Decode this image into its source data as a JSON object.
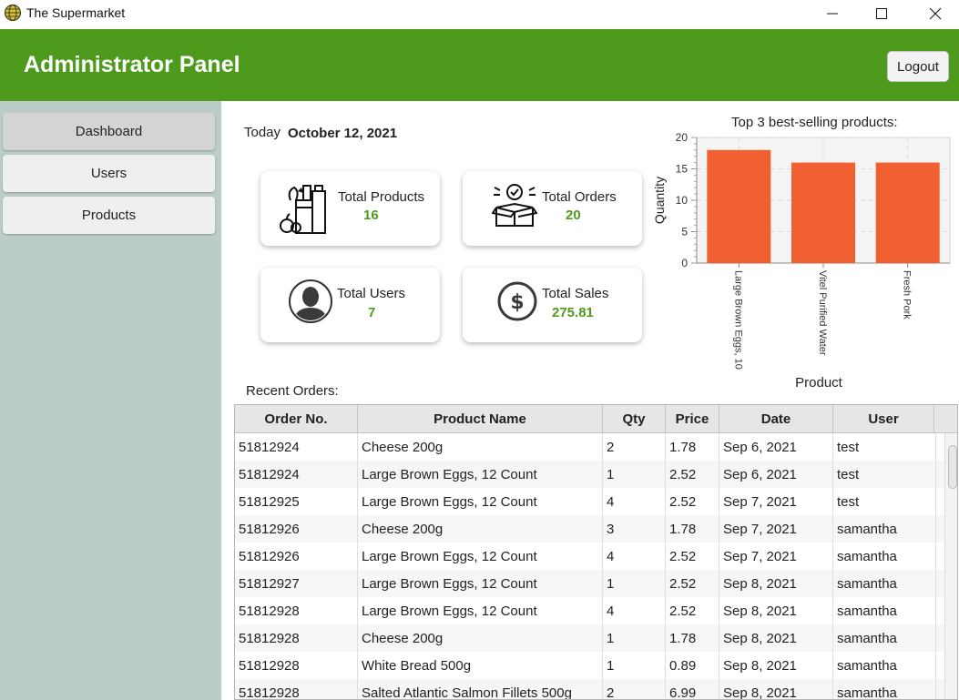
{
  "window": {
    "title": "The Supermarket"
  },
  "header": {
    "title": "Administrator Panel",
    "logout_label": "Logout"
  },
  "sidebar": {
    "items": [
      {
        "label": "Dashboard",
        "active": true
      },
      {
        "label": "Users",
        "active": false
      },
      {
        "label": "Products",
        "active": false
      }
    ]
  },
  "dashboard": {
    "today_label": "Today",
    "today_date": "October 12, 2021",
    "cards": [
      {
        "label": "Total Products",
        "value": "16",
        "icon": "groceries-icon"
      },
      {
        "label": "Total Orders",
        "value": "20",
        "icon": "order-box-icon"
      },
      {
        "label": "Total Users",
        "value": "7",
        "icon": "user-avatar-icon"
      },
      {
        "label": "Total Sales",
        "value": "275.81",
        "icon": "dollar-coin-icon"
      }
    ]
  },
  "chart_data": {
    "type": "bar",
    "title": "Top 3 best-selling products:",
    "xlabel": "Product",
    "ylabel": "Quantity",
    "categories": [
      "Large Brown Eggs, 10",
      "Vitel Purified Water",
      "Fresh Pork"
    ],
    "values": [
      18,
      16,
      16
    ],
    "ylim": [
      0,
      20
    ],
    "yticks": [
      0,
      5,
      10,
      15,
      20
    ],
    "grid": true,
    "bar_color": "#f06030"
  },
  "orders": {
    "label": "Recent Orders:",
    "columns": [
      "Order No.",
      "Product Name",
      "Qty",
      "Price",
      "Date",
      "User"
    ],
    "rows": [
      [
        "51812924",
        "Cheese 200g",
        "2",
        "1.78",
        "Sep 6, 2021",
        "test"
      ],
      [
        "51812924",
        "Large Brown Eggs, 12 Count",
        "1",
        "2.52",
        "Sep 6, 2021",
        "test"
      ],
      [
        "51812925",
        "Large Brown Eggs, 12 Count",
        "4",
        "2.52",
        "Sep 7, 2021",
        "test"
      ],
      [
        "51812926",
        "Cheese 200g",
        "3",
        "1.78",
        "Sep 7, 2021",
        "samantha"
      ],
      [
        "51812926",
        "Large Brown Eggs, 12 Count",
        "4",
        "2.52",
        "Sep 7, 2021",
        "samantha"
      ],
      [
        "51812927",
        "Large Brown Eggs, 12 Count",
        "1",
        "2.52",
        "Sep 8, 2021",
        "samantha"
      ],
      [
        "51812928",
        "Large Brown Eggs, 12 Count",
        "4",
        "2.52",
        "Sep 8, 2021",
        "samantha"
      ],
      [
        "51812928",
        "Cheese 200g",
        "1",
        "1.78",
        "Sep 8, 2021",
        "samantha"
      ],
      [
        "51812928",
        "White Bread 500g",
        "1",
        "0.89",
        "Sep 8, 2021",
        "samantha"
      ],
      [
        "51812928",
        "Salted Atlantic Salmon Fillets 500g",
        "2",
        "6.99",
        "Sep 8, 2021",
        "samantha"
      ]
    ]
  },
  "colors": {
    "header_green": "#4e9a1d",
    "sidebar_bg": "#bccdc7",
    "value_green": "#4e9a1d"
  }
}
